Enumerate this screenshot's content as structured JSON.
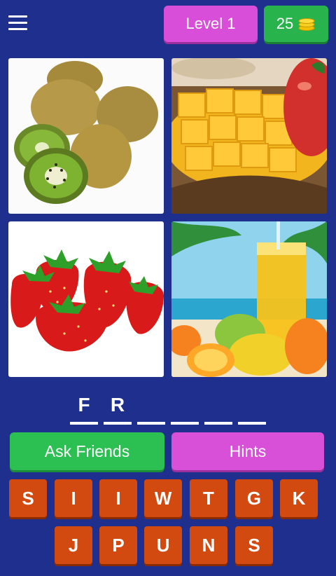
{
  "header": {
    "level_label": "Level 1",
    "coins": "25",
    "coin_icon": "coins-stack-icon",
    "menu_icon": "hamburger-menu-icon"
  },
  "images": [
    {
      "subject": "kiwi"
    },
    {
      "subject": "mango"
    },
    {
      "subject": "strawberries"
    },
    {
      "subject": "orange-juice-and-fruits"
    }
  ],
  "answer": {
    "slots": [
      "F",
      "R",
      "",
      "",
      "",
      ""
    ]
  },
  "buttons": {
    "ask_friends": "Ask Friends",
    "hints": "Hints"
  },
  "keyboard": {
    "row1": [
      "S",
      "I",
      "I",
      "W",
      "T",
      "G",
      "K"
    ],
    "row2": [
      "J",
      "P",
      "U",
      "N",
      "S"
    ]
  },
  "colors": {
    "background": "#1f2f8e",
    "level_pill": "#d94ed8",
    "coins_pill": "#29b34c",
    "key": "#d34a10"
  }
}
